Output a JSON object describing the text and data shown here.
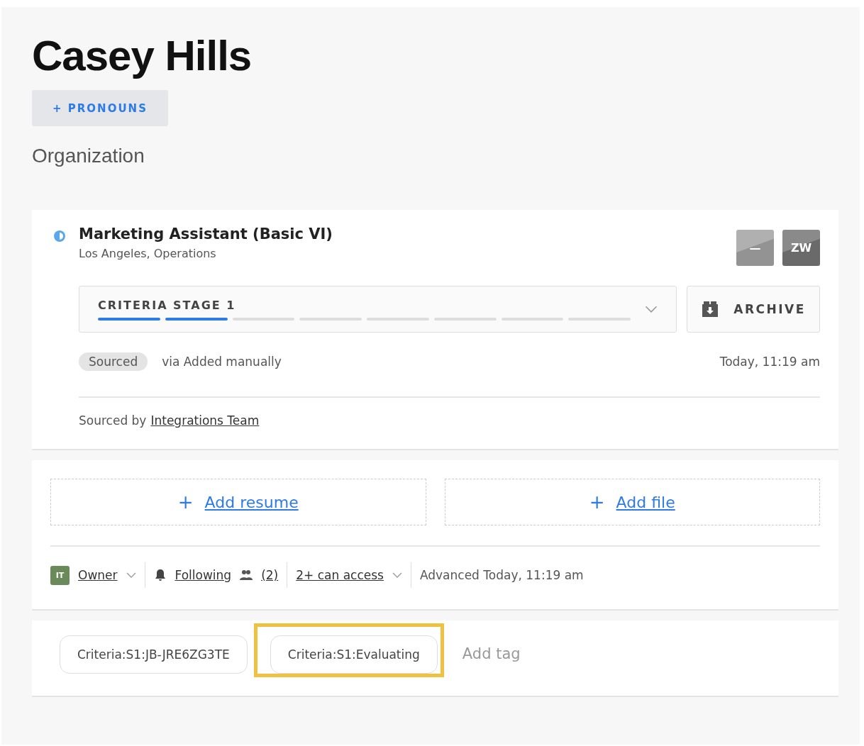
{
  "candidate": {
    "name": "Casey Hills",
    "pronouns_button": "+ PRONOUNS",
    "organization": "Organization"
  },
  "application": {
    "job_title": "Marketing Assistant (Basic VI)",
    "location": "Los Angeles, Operations",
    "reviewers": [
      {
        "initials": "—"
      },
      {
        "initials": "ZW"
      }
    ],
    "stage": {
      "label": "CRITERIA STAGE 1",
      "segments": [
        {
          "complete": true
        },
        {
          "complete": true
        },
        {
          "complete": false
        },
        {
          "complete": false
        },
        {
          "complete": false
        },
        {
          "complete": false
        },
        {
          "complete": false
        },
        {
          "complete": false
        }
      ]
    },
    "archive_button": "ARCHIVE",
    "source_badge": "Sourced",
    "source_via": "via Added manually",
    "timestamp": "Today, 11:19 am",
    "sourced_by_label": "Sourced by",
    "sourced_by_link": "Integrations Team"
  },
  "attachments": [
    {
      "plus": "+",
      "label": "Add resume"
    },
    {
      "plus": "+",
      "label": "Add file"
    }
  ],
  "meta": {
    "owner_initials": "IT",
    "owner": "Owner",
    "following": "Following",
    "followers": "(2)",
    "access": "2+ can access",
    "advanced": "Advanced Today, 11:19 am"
  },
  "tags": [
    {
      "label": "Criteria:S1:JB-JRE6ZG3TE",
      "highlighted": false
    },
    {
      "label": "Criteria:S1:Evaluating",
      "highlighted": true
    }
  ],
  "add_tag_placeholder": "Add tag"
}
